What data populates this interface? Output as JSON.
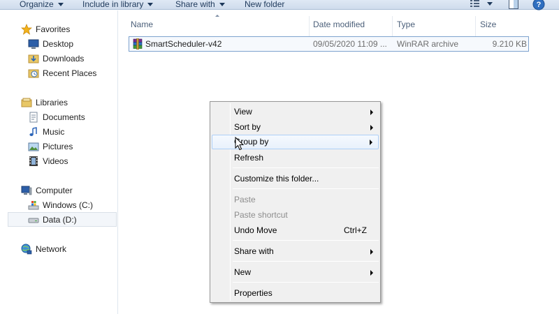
{
  "toolbar": {
    "organize": "Organize",
    "include_in_library": "Include in library",
    "share_with": "Share with",
    "new_folder": "New folder"
  },
  "nav": {
    "favorites": "Favorites",
    "desktop": "Desktop",
    "downloads": "Downloads",
    "recent_places": "Recent Places",
    "libraries": "Libraries",
    "documents": "Documents",
    "music": "Music",
    "pictures": "Pictures",
    "videos": "Videos",
    "computer": "Computer",
    "windows_c": "Windows (C:)",
    "data_d": "Data (D:)",
    "network": "Network"
  },
  "columns": {
    "name": "Name",
    "date_modified": "Date modified",
    "type": "Type",
    "size": "Size"
  },
  "files": [
    {
      "name": "SmartScheduler-v42",
      "date_modified": "09/05/2020 11:09 ...",
      "type": "WinRAR archive",
      "size": "9.210 KB"
    }
  ],
  "context_menu": {
    "view": "View",
    "sort_by": "Sort by",
    "group_by": "Group by",
    "refresh": "Refresh",
    "customize": "Customize this folder...",
    "paste": "Paste",
    "paste_shortcut": "Paste shortcut",
    "undo_move": "Undo Move",
    "undo_shortcut": "Ctrl+Z",
    "share_with": "Share with",
    "new": "New",
    "properties": "Properties"
  },
  "colors": {
    "toolbar_bg": "#dfe9f5",
    "selection_border": "#7da2ce",
    "menu_bg": "#f0f0f0",
    "menu_hover_border": "#aecff7"
  }
}
